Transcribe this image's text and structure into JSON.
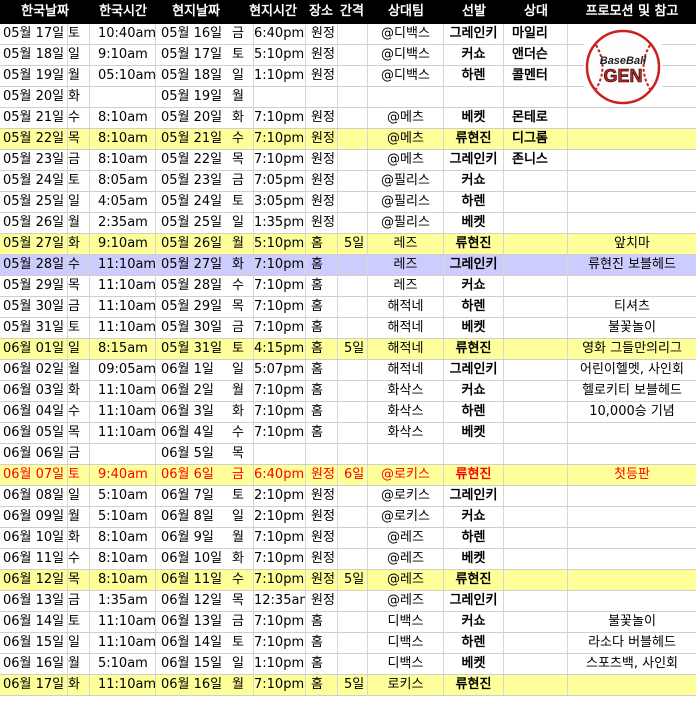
{
  "header": [
    "한국날짜",
    "한국시간",
    "현지날짜",
    "현지시간",
    "장소",
    "간격",
    "상대팀",
    "선발",
    "상대",
    "프로모션 및 참고"
  ],
  "rows": [
    {
      "kd": "05월 17일",
      "kw": "토",
      "kt": "10:40am",
      "ld": "05월 16일",
      "lw": "금",
      "lt": "6:40pm",
      "pl": "원정",
      "gap": "",
      "team": "@디백스",
      "sp": "그레인키",
      "opp": "마일리",
      "promo": "",
      "hl": ""
    },
    {
      "kd": "05월 18일",
      "kw": "일",
      "kt": "9:10am",
      "ld": "05월 17일",
      "lw": "토",
      "lt": "5:10pm",
      "pl": "원정",
      "gap": "",
      "team": "@디백스",
      "sp": "커쇼",
      "opp": "앤더슨",
      "promo": "",
      "hl": ""
    },
    {
      "kd": "05월 19일",
      "kw": "월",
      "kt": "05:10am",
      "ld": "05월 18일",
      "lw": "일",
      "lt": "1:10pm",
      "pl": "원정",
      "gap": "",
      "team": "@디백스",
      "sp": "하렌",
      "opp": "콜멘터",
      "promo": "",
      "hl": ""
    },
    {
      "kd": "05월 20일",
      "kw": "화",
      "kt": "",
      "ld": "05월 19일",
      "lw": "월",
      "lt": "",
      "pl": "",
      "gap": "",
      "team": "",
      "sp": "",
      "opp": "",
      "promo": "",
      "hl": ""
    },
    {
      "kd": "05월 21일",
      "kw": "수",
      "kt": "8:10am",
      "ld": "05월 20일",
      "lw": "화",
      "lt": "7:10pm",
      "pl": "원정",
      "gap": "",
      "team": "@메츠",
      "sp": "베켓",
      "opp": "몬테로",
      "promo": "",
      "hl": ""
    },
    {
      "kd": "05월 22일",
      "kw": "목",
      "kt": "8:10am",
      "ld": "05월 21일",
      "lw": "수",
      "lt": "7:10pm",
      "pl": "원정",
      "gap": "",
      "team": "@메츠",
      "sp": "류현진",
      "opp": "디그롬",
      "promo": "",
      "hl": "yellow"
    },
    {
      "kd": "05월 23일",
      "kw": "금",
      "kt": "8:10am",
      "ld": "05월 22일",
      "lw": "목",
      "lt": "7:10pm",
      "pl": "원정",
      "gap": "",
      "team": "@메츠",
      "sp": "그레인키",
      "opp": "존니스",
      "promo": "",
      "hl": ""
    },
    {
      "kd": "05월 24일",
      "kw": "토",
      "kt": "8:05am",
      "ld": "05월 23일",
      "lw": "금",
      "lt": "7:05pm",
      "pl": "원정",
      "gap": "",
      "team": "@필리스",
      "sp": "커쇼",
      "opp": "",
      "promo": "",
      "hl": ""
    },
    {
      "kd": "05월 25일",
      "kw": "일",
      "kt": "4:05am",
      "ld": "05월 24일",
      "lw": "토",
      "lt": "3:05pm",
      "pl": "원정",
      "gap": "",
      "team": "@필리스",
      "sp": "하렌",
      "opp": "",
      "promo": "",
      "hl": ""
    },
    {
      "kd": "05월 26일",
      "kw": "월",
      "kt": "2:35am",
      "ld": "05월 25일",
      "lw": "일",
      "lt": "1:35pm",
      "pl": "원정",
      "gap": "",
      "team": "@필리스",
      "sp": "베켓",
      "opp": "",
      "promo": "",
      "hl": ""
    },
    {
      "kd": "05월 27일",
      "kw": "화",
      "kt": "9:10am",
      "ld": "05월 26일",
      "lw": "월",
      "lt": "5:10pm",
      "pl": "홈",
      "gap": "5일",
      "team": "레즈",
      "sp": "류현진",
      "opp": "",
      "promo": "앞치마",
      "hl": "yellow"
    },
    {
      "kd": "05월 28일",
      "kw": "수",
      "kt": "11:10am",
      "ld": "05월 27일",
      "lw": "화",
      "lt": "7:10pm",
      "pl": "홈",
      "gap": "",
      "team": "레즈",
      "sp": "그레인키",
      "opp": "",
      "promo": "류현진 보블헤드",
      "hl": "blue"
    },
    {
      "kd": "05월 29일",
      "kw": "목",
      "kt": "11:10am",
      "ld": "05월 28일",
      "lw": "수",
      "lt": "7:10pm",
      "pl": "홈",
      "gap": "",
      "team": "레즈",
      "sp": "커쇼",
      "opp": "",
      "promo": "",
      "hl": ""
    },
    {
      "kd": "05월 30일",
      "kw": "금",
      "kt": "11:10am",
      "ld": "05월 29일",
      "lw": "목",
      "lt": "7:10pm",
      "pl": "홈",
      "gap": "",
      "team": "해적네",
      "sp": "하렌",
      "opp": "",
      "promo": "티셔츠",
      "hl": ""
    },
    {
      "kd": "05월 31일",
      "kw": "토",
      "kt": "11:10am",
      "ld": "05월 30일",
      "lw": "금",
      "lt": "7:10pm",
      "pl": "홈",
      "gap": "",
      "team": "해적네",
      "sp": "베켓",
      "opp": "",
      "promo": "불꽃놀이",
      "hl": ""
    },
    {
      "kd": "06월 01일",
      "kw": "일",
      "kt": "8:15am",
      "ld": "05월 31일",
      "lw": "토",
      "lt": "4:15pm",
      "pl": "홈",
      "gap": "5일",
      "team": "해적네",
      "sp": "류현진",
      "opp": "",
      "promo": "영화 그들만의리그",
      "hl": "yellow"
    },
    {
      "kd": "06월 02일",
      "kw": "월",
      "kt": "09:05am",
      "ld": "06월 1일",
      "lw": "일",
      "lt": "5:07pm",
      "pl": "홈",
      "gap": "",
      "team": "해적네",
      "sp": "그레인키",
      "opp": "",
      "promo": "어린이헬멧, 사인회",
      "hl": ""
    },
    {
      "kd": "06월 03일",
      "kw": "화",
      "kt": "11:10am",
      "ld": "06월 2일",
      "lw": "월",
      "lt": "7:10pm",
      "pl": "홈",
      "gap": "",
      "team": "화삭스",
      "sp": "커쇼",
      "opp": "",
      "promo": "헬로키티 보블헤드",
      "hl": ""
    },
    {
      "kd": "06월 04일",
      "kw": "수",
      "kt": "11:10am",
      "ld": "06월 3일",
      "lw": "화",
      "lt": "7:10pm",
      "pl": "홈",
      "gap": "",
      "team": "화삭스",
      "sp": "하렌",
      "opp": "",
      "promo": "10,000승 기념",
      "hl": ""
    },
    {
      "kd": "06월 05일",
      "kw": "목",
      "kt": "11:10am",
      "ld": "06월 4일",
      "lw": "수",
      "lt": "7:10pm",
      "pl": "홈",
      "gap": "",
      "team": "화삭스",
      "sp": "베켓",
      "opp": "",
      "promo": "",
      "hl": ""
    },
    {
      "kd": "06월 06일",
      "kw": "금",
      "kt": "",
      "ld": "06월 5일",
      "lw": "목",
      "lt": "",
      "pl": "",
      "gap": "",
      "team": "",
      "sp": "",
      "opp": "",
      "promo": "",
      "hl": ""
    },
    {
      "kd": "06월 07일",
      "kw": "토",
      "kt": "9:40am",
      "ld": "06월 6일",
      "lw": "금",
      "lt": "6:40pm",
      "pl": "원정",
      "gap": "6일",
      "team": "@로키스",
      "sp": "류현진",
      "opp": "",
      "promo": "첫등판",
      "hl": "yellow red"
    },
    {
      "kd": "06월 08일",
      "kw": "일",
      "kt": "5:10am",
      "ld": "06월 7일",
      "lw": "토",
      "lt": "2:10pm",
      "pl": "원정",
      "gap": "",
      "team": "@로키스",
      "sp": "그레인키",
      "opp": "",
      "promo": "",
      "hl": ""
    },
    {
      "kd": "06월 09일",
      "kw": "월",
      "kt": "5:10am",
      "ld": "06월 8일",
      "lw": "일",
      "lt": "2:10pm",
      "pl": "원정",
      "gap": "",
      "team": "@로키스",
      "sp": "커쇼",
      "opp": "",
      "promo": "",
      "hl": ""
    },
    {
      "kd": "06월 10일",
      "kw": "화",
      "kt": "8:10am",
      "ld": "06월 9일",
      "lw": "월",
      "lt": "7:10pm",
      "pl": "원정",
      "gap": "",
      "team": "@레즈",
      "sp": "하렌",
      "opp": "",
      "promo": "",
      "hl": ""
    },
    {
      "kd": "06월 11일",
      "kw": "수",
      "kt": "8:10am",
      "ld": "06월 10일",
      "lw": "화",
      "lt": "7:10pm",
      "pl": "원정",
      "gap": "",
      "team": "@레즈",
      "sp": "베켓",
      "opp": "",
      "promo": "",
      "hl": ""
    },
    {
      "kd": "06월 12일",
      "kw": "목",
      "kt": "8:10am",
      "ld": "06월 11일",
      "lw": "수",
      "lt": "7:10pm",
      "pl": "원정",
      "gap": "5일",
      "team": "@레즈",
      "sp": "류현진",
      "opp": "",
      "promo": "",
      "hl": "yellow"
    },
    {
      "kd": "06월 13일",
      "kw": "금",
      "kt": "1:35am",
      "ld": "06월 12일",
      "lw": "목",
      "lt": "12:35am",
      "pl": "원정",
      "gap": "",
      "team": "@레즈",
      "sp": "그레인키",
      "opp": "",
      "promo": "",
      "hl": ""
    },
    {
      "kd": "06월 14일",
      "kw": "토",
      "kt": "11:10am",
      "ld": "06월 13일",
      "lw": "금",
      "lt": "7:10pm",
      "pl": "홈",
      "gap": "",
      "team": "디백스",
      "sp": "커쇼",
      "opp": "",
      "promo": "불꽃놀이",
      "hl": ""
    },
    {
      "kd": "06월 15일",
      "kw": "일",
      "kt": "11:10am",
      "ld": "06월 14일",
      "lw": "토",
      "lt": "7:10pm",
      "pl": "홈",
      "gap": "",
      "team": "디백스",
      "sp": "하렌",
      "opp": "",
      "promo": "라소다 버블헤드",
      "hl": ""
    },
    {
      "kd": "06월 16일",
      "kw": "월",
      "kt": "5:10am",
      "ld": "06월 15일",
      "lw": "일",
      "lt": "1:10pm",
      "pl": "홈",
      "gap": "",
      "team": "디백스",
      "sp": "베켓",
      "opp": "",
      "promo": "스포츠백, 사인회",
      "hl": ""
    },
    {
      "kd": "06월 17일",
      "kw": "화",
      "kt": "11:10am",
      "ld": "06월 16일",
      "lw": "월",
      "lt": "7:10pm",
      "pl": "홈",
      "gap": "5일",
      "team": "로키스",
      "sp": "류현진",
      "opp": "",
      "promo": "",
      "hl": "yellow"
    }
  ],
  "logo": {
    "line1": "BaseBall",
    "line2": "GEN",
    "ball_color": "#cc1f1f",
    "text_color": "#ffffff"
  }
}
